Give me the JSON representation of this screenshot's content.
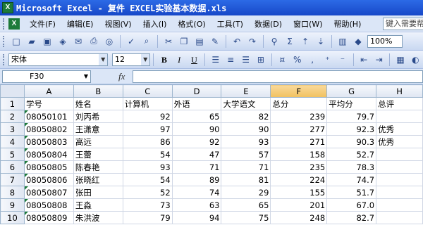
{
  "window": {
    "title": "Microsoft Excel - 复件 EXCEL实验基本数据.xls"
  },
  "menu": {
    "items": [
      "文件(F)",
      "编辑(E)",
      "视图(V)",
      "插入(I)",
      "格式(O)",
      "工具(T)",
      "数据(D)",
      "窗口(W)",
      "帮助(H)"
    ],
    "help_placeholder": "键入需要帮助的问题"
  },
  "toolbar": {
    "zoom": "100%"
  },
  "format_toolbar": {
    "font": "宋体",
    "size": "12",
    "bold": "B",
    "italic": "I",
    "underline": "U"
  },
  "formula_bar": {
    "name_box": "F30",
    "fx": "fx",
    "formula": ""
  },
  "sheet": {
    "columns": [
      "A",
      "B",
      "C",
      "D",
      "E",
      "F",
      "G",
      "H"
    ],
    "active_column": "F",
    "rows": [
      {
        "n": "1",
        "cells": [
          "学号",
          "姓名",
          "计算机",
          "外语",
          "大学语文",
          "总分",
          "平均分",
          "总评"
        ]
      },
      {
        "n": "2",
        "cells": [
          "08050101",
          "刘丙希",
          "92",
          "65",
          "82",
          "239",
          "79.7",
          ""
        ]
      },
      {
        "n": "3",
        "cells": [
          "08050802",
          "王潇意",
          "97",
          "90",
          "90",
          "277",
          "92.3",
          "优秀"
        ]
      },
      {
        "n": "4",
        "cells": [
          "08050803",
          "高远",
          "86",
          "92",
          "93",
          "271",
          "90.3",
          "优秀"
        ]
      },
      {
        "n": "5",
        "cells": [
          "08050804",
          "王蕾",
          "54",
          "47",
          "57",
          "158",
          "52.7",
          ""
        ]
      },
      {
        "n": "6",
        "cells": [
          "08050805",
          "陈春艳",
          "93",
          "71",
          "71",
          "235",
          "78.3",
          ""
        ]
      },
      {
        "n": "7",
        "cells": [
          "08050806",
          "张晓红",
          "54",
          "89",
          "81",
          "224",
          "74.7",
          ""
        ]
      },
      {
        "n": "8",
        "cells": [
          "08050807",
          "张田",
          "52",
          "74",
          "29",
          "155",
          "51.7",
          ""
        ]
      },
      {
        "n": "9",
        "cells": [
          "08050808",
          "王淼",
          "73",
          "63",
          "65",
          "201",
          "67.0",
          ""
        ]
      },
      {
        "n": "10",
        "cells": [
          "08050809",
          "朱洪波",
          "79",
          "94",
          "75",
          "248",
          "82.7",
          ""
        ]
      }
    ]
  }
}
